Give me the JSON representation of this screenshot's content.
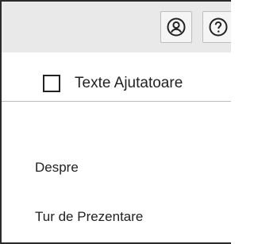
{
  "toolbar": {
    "buttons": [
      {
        "icon": "account-icon"
      },
      {
        "icon": "help-icon"
      }
    ]
  },
  "menu": {
    "checkbox": {
      "label": "Texte Ajutatoare",
      "checked": false
    },
    "items": [
      {
        "label": "Despre"
      },
      {
        "label": "Tur de Prezentare"
      }
    ]
  }
}
